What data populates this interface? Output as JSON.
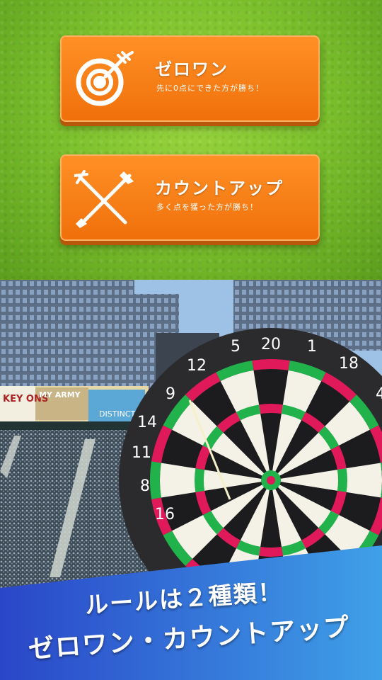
{
  "modes": [
    {
      "title": "ゼロワン",
      "subtitle": "先に0点にできた方が勝ち！",
      "icon": "target-dart-icon"
    },
    {
      "title": "カウントアップ",
      "subtitle": "多く点を獲った方が勝ち！",
      "icon": "crossed-darts-icon"
    }
  ],
  "dartboard": {
    "numbers": [
      "5",
      "20",
      "1",
      "18",
      "4",
      "12",
      "9",
      "14",
      "11",
      "8",
      "16"
    ]
  },
  "billboard": {
    "left_text": "KEY ONS",
    "army_text": "MY ARMY",
    "distinct_text": "DISTINCTI"
  },
  "banner": {
    "line1": "ルールは２種類！",
    "line2": "ゼロワン・カウントアップ"
  },
  "colors": {
    "button_orange": "#f27a10",
    "board_red": "#e0195a",
    "board_green": "#22b24c",
    "banner_blue": "#2f5fd0"
  }
}
